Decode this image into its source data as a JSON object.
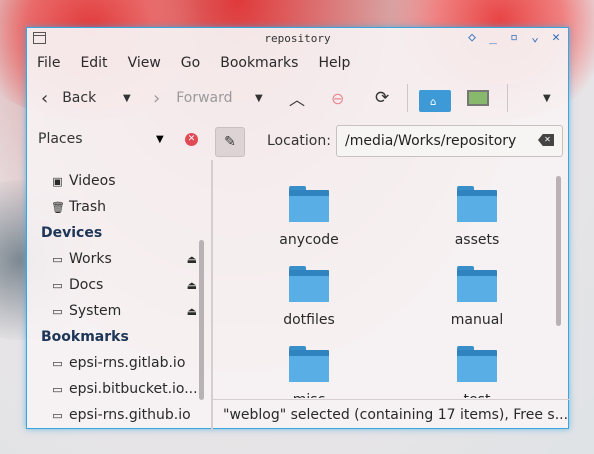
{
  "window": {
    "title": "repository"
  },
  "titlebar_buttons": [
    "◇",
    "_",
    "▫",
    "⌄",
    "✕"
  ],
  "menu": [
    "File",
    "Edit",
    "View",
    "Go",
    "Bookmarks",
    "Help"
  ],
  "toolbar": {
    "back": "Back",
    "forward": "Forward"
  },
  "places": {
    "label": "Places"
  },
  "location": {
    "label": "Location:",
    "value": "/media/Works/repository"
  },
  "sidebar": {
    "items": [
      {
        "icon": "video-icon",
        "label": "Videos"
      },
      {
        "icon": "trash-icon",
        "label": "Trash"
      }
    ],
    "devices_header": "Devices",
    "devices": [
      {
        "label": "Works"
      },
      {
        "label": "Docs"
      },
      {
        "label": "System"
      }
    ],
    "bookmarks_header": "Bookmarks",
    "bookmarks": [
      {
        "label": "epsi-rns.gitlab.io"
      },
      {
        "label": "epsi.bitbucket.io..."
      },
      {
        "label": "epsi-rns.github.io"
      }
    ]
  },
  "files": [
    "anycode",
    "assets",
    "dotfiles",
    "manual",
    "misc",
    "test"
  ],
  "status": "\"weblog\" selected (containing 17 items), Free s...",
  "colors": {
    "accent": "#3aa6e0",
    "folder": "#5aaee6",
    "close": "#e04a55"
  }
}
